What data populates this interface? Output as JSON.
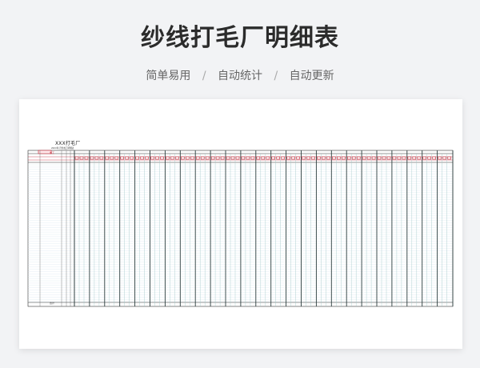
{
  "hero": {
    "title": "纱线打毛厂明细表",
    "features": [
      "简单易用",
      "自动统计",
      "自动更新"
    ],
    "separator": "/"
  },
  "sheet": {
    "title": "XXX打毛厂",
    "subtitle": "20XX年 月份加工明细表",
    "tag": "加工",
    "total_label": "合计",
    "accent_color": "#c02030",
    "grid_color": "#9fc7c7"
  }
}
